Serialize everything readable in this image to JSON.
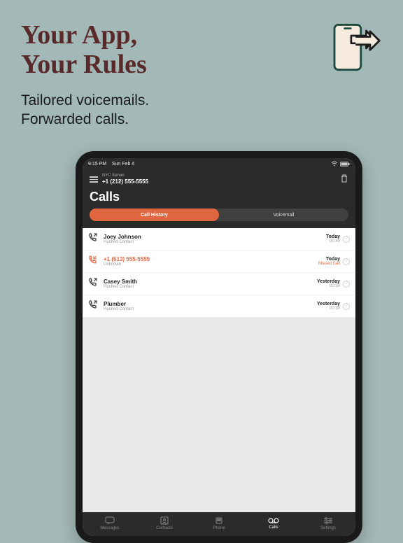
{
  "hero": {
    "title_line1": "Your App,",
    "title_line2": "Your Rules",
    "sub_line1": "Tailored voicemails.",
    "sub_line2": "Forwarded calls."
  },
  "statusbar": {
    "time": "9:15 PM",
    "date": "Sun Feb 4"
  },
  "header": {
    "account_label": "NYC Kenan",
    "phone_number": "+1 (212) 555-5555",
    "title": "Calls"
  },
  "tabs": {
    "history": "Call History",
    "voicemail": "Voicemail"
  },
  "calls": [
    {
      "name": "Joey Johnson",
      "sub": "Hushed Contact",
      "date": "Today",
      "duration": "00:40",
      "missed": false
    },
    {
      "name": "+1 (613) 555-5555",
      "sub": "Unknown",
      "date": "Today",
      "duration": "Missed Call",
      "missed": true
    },
    {
      "name": "Casey Smith",
      "sub": "Hushed Contact",
      "date": "Yesterday",
      "duration": "00:30",
      "missed": false
    },
    {
      "name": "Plumber",
      "sub": "Hushed Contact",
      "date": "Yesterday",
      "duration": "00:30",
      "missed": false
    }
  ],
  "nav": {
    "messages": "Messages",
    "contacts": "Contacts",
    "phone": "Phone",
    "calls": "Calls",
    "settings": "Settings"
  }
}
